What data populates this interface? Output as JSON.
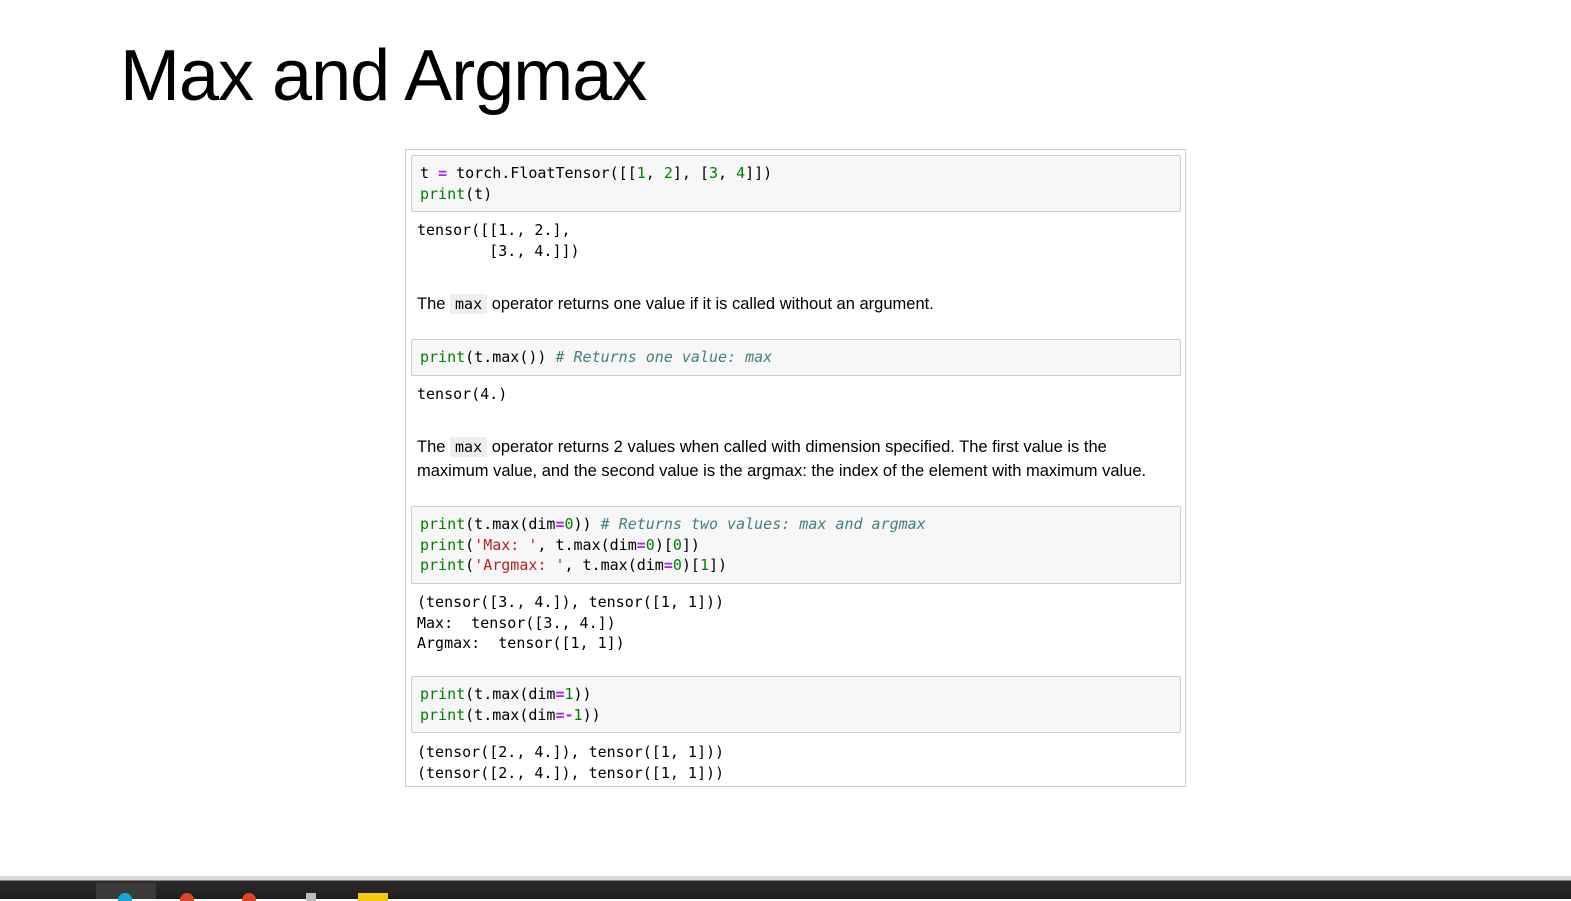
{
  "slide": {
    "title": "Max and Argmax"
  },
  "cells": {
    "in1": {
      "line1_a": "t ",
      "line1_op": "=",
      "line1_b": " torch.FloatTensor([[",
      "n1": "1",
      "c1": ", ",
      "n2": "2",
      "c2": "], [",
      "n3": "3",
      "c3": ", ",
      "n4": "4",
      "c4": "]])",
      "line2_kw": "print",
      "line2_rest": "(t)"
    },
    "out1": "tensor([[1., 2.],\n        [3., 4.]])",
    "md1": {
      "pre": "The ",
      "code": "max",
      "post": " operator returns one value if it is called without an argument."
    },
    "in2": {
      "kw": "print",
      "rest": "(t.max()) ",
      "comment": "# Returns one value: max"
    },
    "out2": "tensor(4.)",
    "md2": {
      "pre": "The ",
      "code": "max",
      "post": " operator returns 2 values when called with dimension specified. The first value is the maximum value, and the second value is the argmax: the index of the element with maximum value."
    },
    "in3": {
      "l1_kw": "print",
      "l1_a": "(t.max(dim",
      "l1_op": "=",
      "l1_n": "0",
      "l1_b": ")) ",
      "l1_cm": "# Returns two values: max and argmax",
      "l2_kw": "print",
      "l2_a": "(",
      "l2_str": "'Max: '",
      "l2_b": ", t.max(dim",
      "l2_op": "=",
      "l2_n": "0",
      "l2_c": ")[",
      "l2_n2": "0",
      "l2_d": "])",
      "l3_kw": "print",
      "l3_a": "(",
      "l3_str": "'Argmax: '",
      "l3_b": ", t.max(dim",
      "l3_op": "=",
      "l3_n": "0",
      "l3_c": ")[",
      "l3_n2": "1",
      "l3_d": "])"
    },
    "out3": "(tensor([3., 4.]), tensor([1, 1]))\nMax:  tensor([3., 4.])\nArgmax:  tensor([1, 1])",
    "in4": {
      "l1_kw": "print",
      "l1_a": "(t.max(dim",
      "l1_op": "=",
      "l1_n": "1",
      "l1_b": "))",
      "l2_kw": "print",
      "l2_a": "(t.max(dim",
      "l2_op": "=-",
      "l2_n": "1",
      "l2_b": "))"
    },
    "out4": "(tensor([2., 4.]), tensor([1, 1]))\n(tensor([2., 4.]), tensor([1, 1]))"
  },
  "taskbar": {
    "icon_colors": [
      "#1fa3d6",
      "#d9472b",
      "#d9472b",
      "#bbbbbb",
      "#f2c811"
    ]
  }
}
